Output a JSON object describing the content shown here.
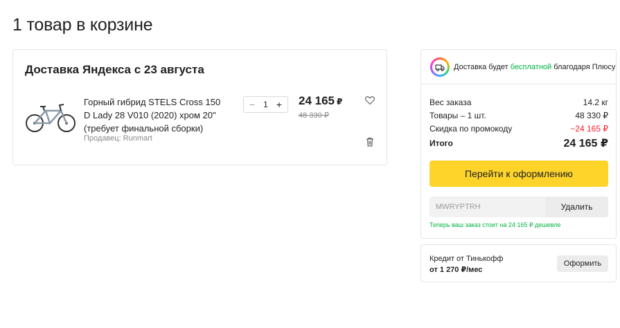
{
  "page": {
    "title": "1 товар в корзине"
  },
  "cart": {
    "delivery_heading": "Доставка Яндекса с 23 августа",
    "item": {
      "image": "bicycle-image",
      "title": "Горный гибрид STELS Cross 150 D Lady 28 V010 (2020) хром 20\" (требует финальной сборки)",
      "seller": "Продавец: Runmart",
      "quantity": "1",
      "minus_label": "−",
      "plus_label": "+",
      "price": "24 165",
      "currency": "₽",
      "old_price": "48 330 ₽"
    }
  },
  "summary": {
    "plus_text_before": "Доставка будет ",
    "plus_text_highlight": "бесплатной",
    "plus_text_after": " благодаря Плюсу",
    "rows": [
      {
        "label": "Вес заказа",
        "value": "14.2 кг"
      },
      {
        "label": "Товары – 1 шт.",
        "value": "48 330 ₽"
      },
      {
        "label": "Скидка по промокоду",
        "value": "−24 165 ₽"
      }
    ],
    "total_label": "Итого",
    "total_value": "24 165 ₽",
    "checkout_label": "Перейти к оформлению",
    "promo_code": "MWRYPTRH",
    "remove_label": "Удалить",
    "promo_note": "Теперь ваш заказ стоит на 24 165 ₽ дешевле"
  },
  "credit": {
    "title": "Кредит от Тинькофф",
    "subtitle": "от 1 270 ₽/мес",
    "button_label": "Оформить"
  },
  "colors": {
    "accent_yellow": "#fed42b",
    "green": "#00b341",
    "red": "#f5222d"
  }
}
